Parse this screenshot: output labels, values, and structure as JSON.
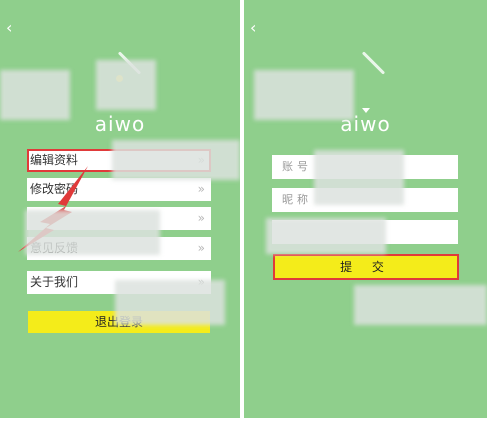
{
  "left": {
    "back_icon": "‹",
    "logo": "aiwo",
    "menu": [
      {
        "label": "编辑资料",
        "chevron": "»"
      },
      {
        "label": "修改密码",
        "chevron": "»"
      },
      {
        "label": "",
        "chevron": "»"
      },
      {
        "label": "意见反馈",
        "chevron": "»"
      },
      {
        "label": "关于我们",
        "chevron": "»"
      }
    ],
    "logout_label": "退出登录"
  },
  "right": {
    "back_icon": "‹",
    "logo": "aiwo",
    "fields": [
      {
        "label": "账号"
      },
      {
        "label": "昵称"
      },
      {
        "label": ""
      }
    ],
    "submit_label": "提 交"
  },
  "colors": {
    "background": "#8fcf8c",
    "accent_yellow": "#f4ec1a",
    "highlight_red": "#e03a3a"
  }
}
